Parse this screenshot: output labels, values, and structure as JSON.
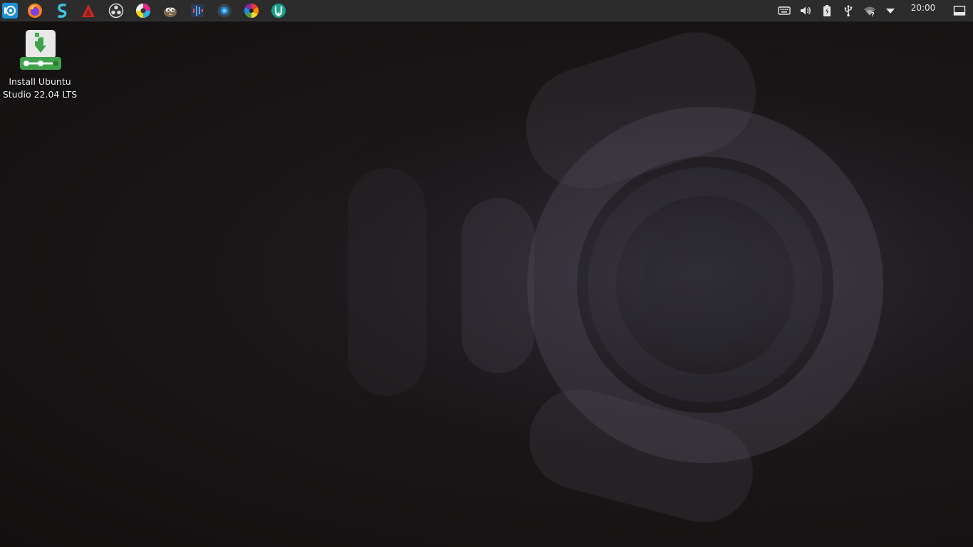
{
  "panel": {
    "launchers": [
      {
        "icon": "ubuntu-studio-menu-icon"
      },
      {
        "icon": "firefox-icon"
      },
      {
        "icon": "audio-app-s-icon"
      },
      {
        "icon": "ardour-icon"
      },
      {
        "icon": "obs-studio-icon"
      },
      {
        "icon": "krita-icon"
      },
      {
        "icon": "gimp-icon"
      },
      {
        "icon": "audacity-icon"
      },
      {
        "icon": "carla-icon"
      },
      {
        "icon": "darktable-icon"
      },
      {
        "icon": "kdenlive-icon"
      }
    ],
    "tray": [
      {
        "icon": "keyboard-icon"
      },
      {
        "icon": "volume-icon"
      },
      {
        "icon": "battery-icon"
      },
      {
        "icon": "usb-icon"
      },
      {
        "icon": "wifi-unknown-icon"
      },
      {
        "icon": "tray-expand-icon"
      },
      {
        "icon": "show-desktop-icon"
      }
    ],
    "clock": "20:00"
  },
  "desktop": {
    "icon": {
      "name": "installer-icon",
      "label": "Install Ubuntu Studio 22.04 LTS"
    }
  },
  "colors": {
    "panel_bg": "#2c2c2c",
    "installer_green": "#3fa34d",
    "menu_blue": "#1d8fd6"
  }
}
